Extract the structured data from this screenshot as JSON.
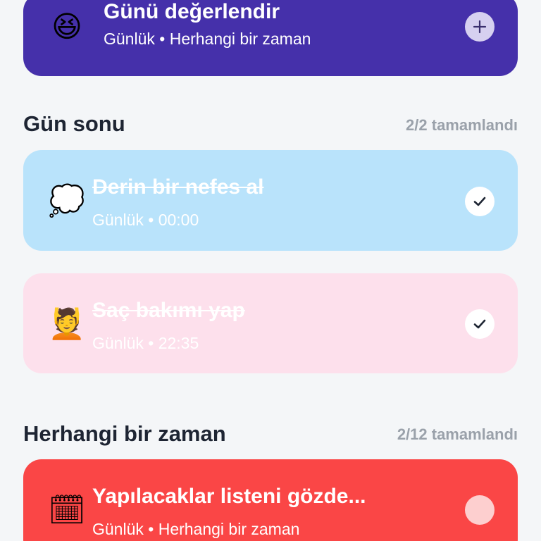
{
  "tasks_top": {
    "emoji": "😆",
    "icon": "laughing-face-icon",
    "title": "Günü değerlendir",
    "subtitle": "Günlük • Herhangi bir zaman",
    "action_icon": "plus-icon"
  },
  "section_end_of_day": {
    "title": "Gün sonu",
    "count": "2/2 tamamlandı",
    "items": [
      {
        "emoji": "💭",
        "icon": "thought-bubble-icon",
        "title": "Derin bir nefes al",
        "subtitle": "Günlük • 00:00",
        "completed": true,
        "color": "#b9e3fb"
      },
      {
        "emoji": "💆",
        "icon": "massage-icon",
        "title": "Saç bakımı yap",
        "subtitle": "Günlük • 22:35",
        "completed": true,
        "color": "#fde0ec"
      }
    ]
  },
  "section_anytime": {
    "title": "Herhangi bir zaman",
    "count": "2/12 tamamlandı",
    "items": [
      {
        "emoji": "🗓",
        "icon": "spiral-calendar-icon",
        "title": "Yapılacaklar listeni gözde...",
        "subtitle": "Günlük • Herhangi bir zaman",
        "completed": false,
        "color": "#fa4646"
      }
    ]
  },
  "colors": {
    "background": "#f4f6f8",
    "purple_card": "#4530aa",
    "section_title": "#1e2533",
    "section_count": "#9aa1aa"
  }
}
